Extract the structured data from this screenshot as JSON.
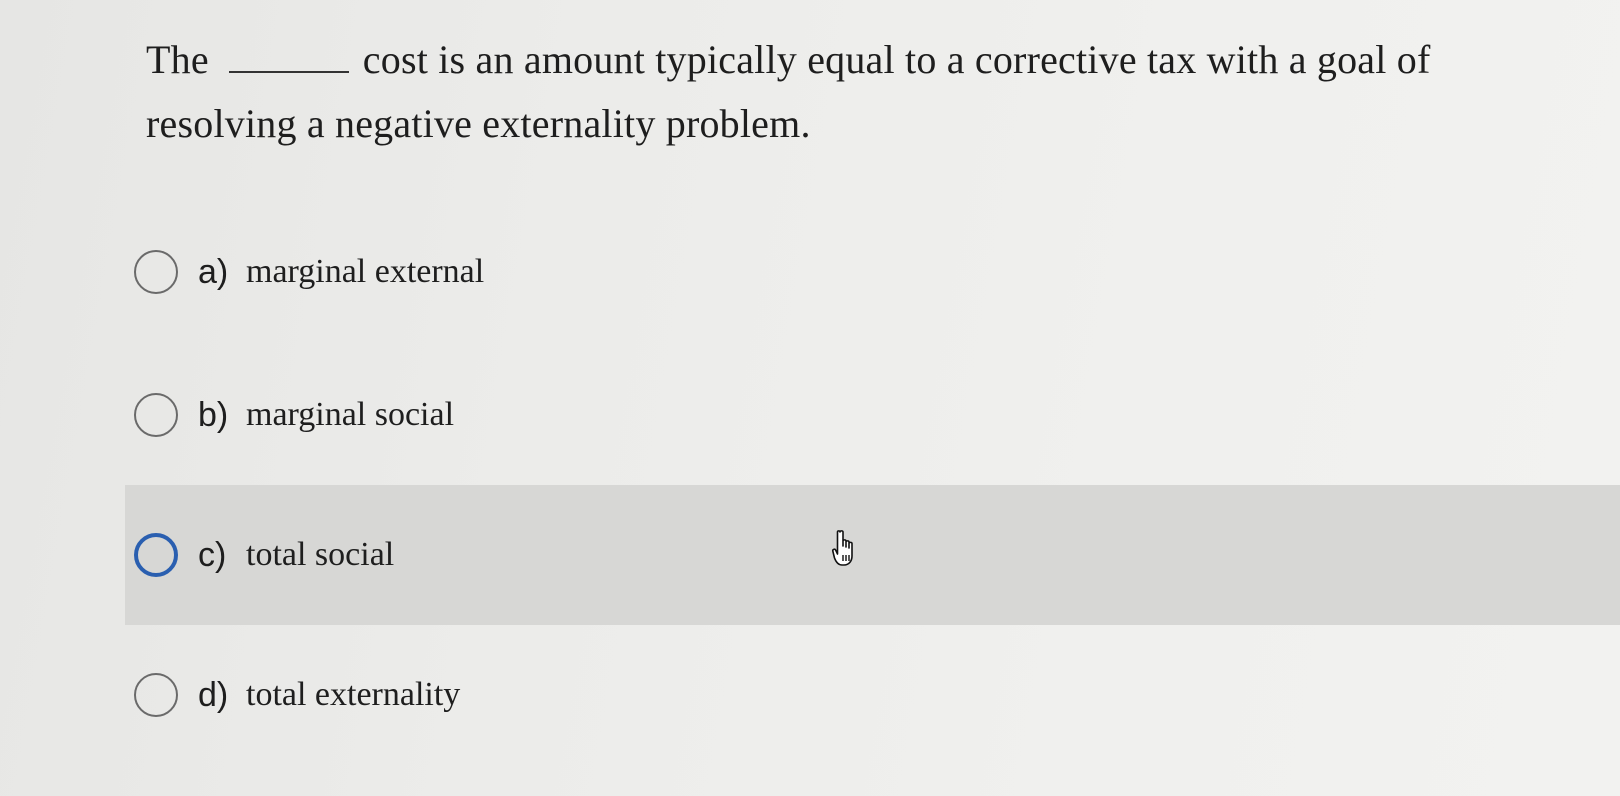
{
  "question": {
    "before_blank": "The",
    "after_blank": "cost is an amount typically equal to a corrective tax with a goal of resolving a negative externality problem."
  },
  "options": [
    {
      "letter": "a)",
      "text": "marginal external"
    },
    {
      "letter": "b)",
      "text": "marginal social"
    },
    {
      "letter": "c)",
      "text": "total social"
    },
    {
      "letter": "d)",
      "text": "total externality"
    }
  ],
  "highlighted_option": "c",
  "colors": {
    "highlight_bg": "#d7d7d5",
    "selected_radio_border": "#2a5fb0",
    "radio_border": "#6a6a6a"
  },
  "icons": {
    "cursor": "hand-pointer-icon"
  }
}
